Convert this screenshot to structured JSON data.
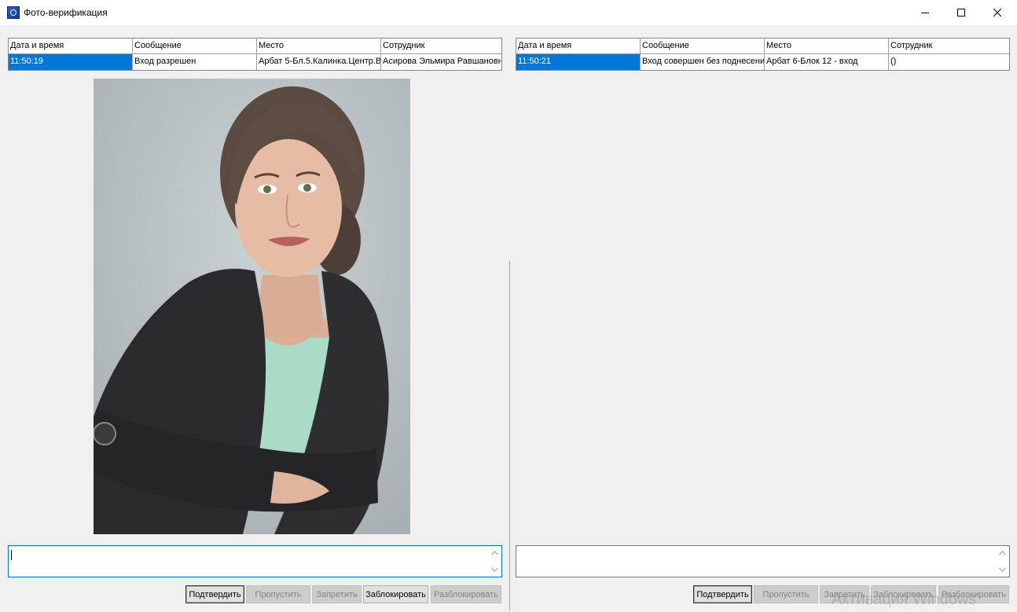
{
  "window": {
    "title": "Фото-верификация",
    "app_icon": "cube-app-icon",
    "controls": [
      "minimize-icon",
      "maximize-icon",
      "close-icon"
    ]
  },
  "columns": [
    "Дата и время",
    "Сообщение",
    "Место",
    "Сотрудник"
  ],
  "left_panel": {
    "events": [
      {
        "time": "11:50:19",
        "message": "Вход разрешен",
        "place": "Арбат 5-Бл.5.Калинка.Центр.В",
        "employee": "Асирова Эльмира Равшановн"
      }
    ],
    "comment": "",
    "buttons": [
      {
        "label": "Подтвердить",
        "enabled": true
      },
      {
        "label": "Пропустить",
        "enabled": false
      },
      {
        "label": "Запретить",
        "enabled": false
      },
      {
        "label": "Заблокировать",
        "enabled": true
      },
      {
        "label": "Разблокировать",
        "enabled": false
      }
    ]
  },
  "right_panel": {
    "events": [
      {
        "time": "11:50:21",
        "message": "Вход совершен без поднесени",
        "place": "Арбат 6-Блок 12 - вход",
        "employee": "()"
      }
    ],
    "comment": "",
    "buttons": [
      {
        "label": "Подтвердить",
        "enabled": true
      },
      {
        "label": "Пропустить",
        "enabled": false
      },
      {
        "label": "Запретить",
        "enabled": false
      },
      {
        "label": "Заблокировать",
        "enabled": false
      },
      {
        "label": "Разблокировать",
        "enabled": false
      }
    ]
  },
  "watermark": "Активация Windows",
  "colors": {
    "selection": "#0078d7",
    "background": "#f0f0f0"
  }
}
